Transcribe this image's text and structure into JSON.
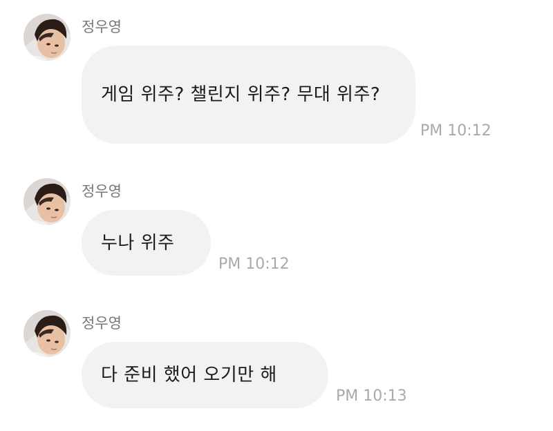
{
  "messages": [
    {
      "sender": "정우영",
      "text": "게임 위주? 챌린지 위주? 무대 위주?",
      "time": "PM 10:12"
    },
    {
      "sender": "정우영",
      "text": "누나 위주",
      "time": "PM 10:12"
    },
    {
      "sender": "정우영",
      "text": "다 준비 했어 오기만 해",
      "time": "PM 10:13"
    }
  ],
  "colors": {
    "bubble": "#f2f2f4",
    "sender": "#777777",
    "timestamp": "#a9a9ad",
    "text": "#1a1a1a"
  },
  "icons": {
    "avatar": "profile-photo"
  }
}
